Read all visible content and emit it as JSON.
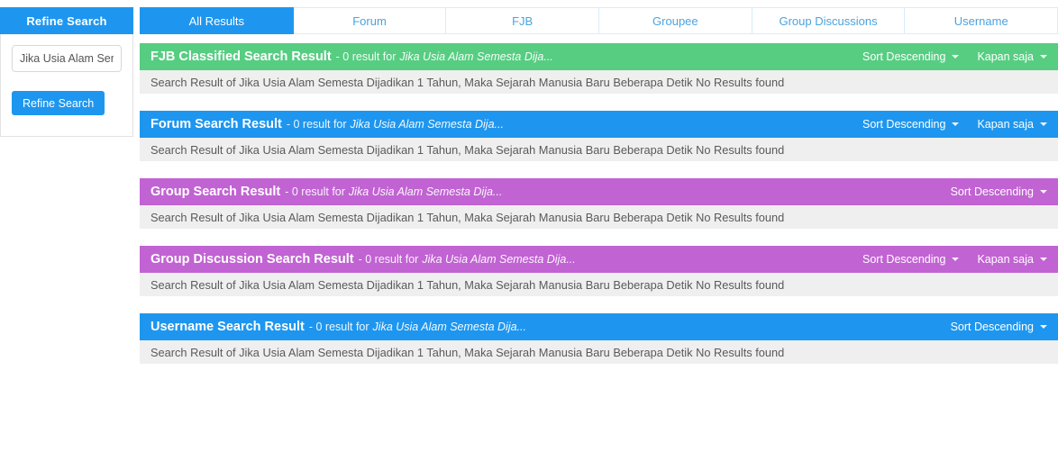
{
  "sidebar": {
    "header_label": "Refine Search",
    "search_input_value": "Jika Usia Alam Ser",
    "search_input_placeholder": "Jika Usia Alam Ser",
    "refine_button_label": "Refine Search"
  },
  "tabs": [
    {
      "label": "All Results",
      "active": true
    },
    {
      "label": "Forum",
      "active": false
    },
    {
      "label": "FJB",
      "active": false
    },
    {
      "label": "Groupee",
      "active": false
    },
    {
      "label": "Group Discussions",
      "active": false
    },
    {
      "label": "Username",
      "active": false
    }
  ],
  "colors": {
    "green": "#57cd82",
    "blue": "#1e96ef",
    "purple": "#c163d3",
    "body_background": "#efefef",
    "text_muted": "#5a5a5a"
  },
  "sections": [
    {
      "title": "FJB Classified Search Result",
      "count_text": "- 0 result for",
      "query": "Jika Usia Alam Semesta Dija...",
      "color": "green",
      "sort_label": "Sort Descending",
      "time_label": "Kapan saja",
      "body": "Search Result of Jika Usia Alam Semesta Dijadikan 1 Tahun, Maka Sejarah Manusia Baru Beberapa Detik No Results found"
    },
    {
      "title": "Forum Search Result",
      "count_text": "- 0 result for",
      "query": "Jika Usia Alam Semesta Dija...",
      "color": "blue",
      "sort_label": "Sort Descending",
      "time_label": "Kapan saja",
      "body": "Search Result of Jika Usia Alam Semesta Dijadikan 1 Tahun, Maka Sejarah Manusia Baru Beberapa Detik No Results found"
    },
    {
      "title": "Group Search Result",
      "count_text": "- 0 result for",
      "query": "Jika Usia Alam Semesta Dija...",
      "color": "purple",
      "sort_label": "Sort Descending",
      "time_label": "",
      "body": "Search Result of Jika Usia Alam Semesta Dijadikan 1 Tahun, Maka Sejarah Manusia Baru Beberapa Detik No Results found"
    },
    {
      "title": "Group Discussion Search Result",
      "count_text": "- 0 result for",
      "query": "Jika Usia Alam Semesta Dija...",
      "color": "purple",
      "sort_label": "Sort Descending",
      "time_label": "Kapan saja",
      "body": "Search Result of Jika Usia Alam Semesta Dijadikan 1 Tahun, Maka Sejarah Manusia Baru Beberapa Detik No Results found"
    },
    {
      "title": "Username Search Result",
      "count_text": "- 0 result for",
      "query": "Jika Usia Alam Semesta Dija...",
      "color": "blue",
      "sort_label": "Sort Descending",
      "time_label": "",
      "body": "Search Result of Jika Usia Alam Semesta Dijadikan 1 Tahun, Maka Sejarah Manusia Baru Beberapa Detik No Results found"
    }
  ]
}
